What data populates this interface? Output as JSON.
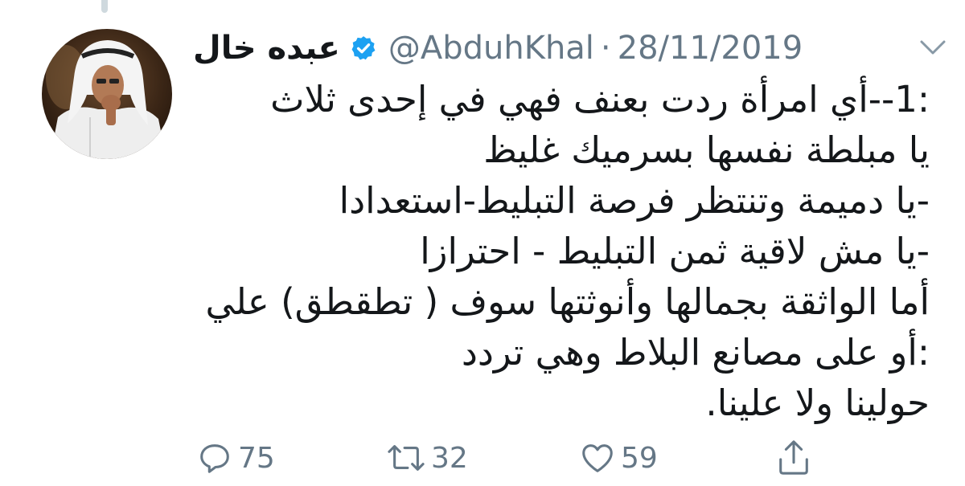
{
  "tweet": {
    "author": {
      "display_name": "عبده خال",
      "handle": "@AbduhKhal",
      "verified": true,
      "avatar_icon": "profile-photo"
    },
    "separator": "·",
    "date": "28/11/2019",
    "menu_icon": "chevron-down-icon",
    "text_lines": [
      ":1--أي امرأة ردت بعنف فهي في إحدى ثلاث",
      "يا مبلطة نفسها بسرميك غليظ",
      "-يا دميمة وتنتظر فرصة التبليط-استعدادا",
      "-يا مش لاقية ثمن التبليط - احترازا",
      "أما الواثقة بجمالها وأنوثتها سوف ( تطقطق) علي",
      ":أو على مصانع البلاط وهي تردد",
      "حولينا ولا علينا."
    ],
    "actions": {
      "reply": {
        "icon": "reply-icon",
        "count": "75"
      },
      "retweet": {
        "icon": "retweet-icon",
        "count": "32"
      },
      "like": {
        "icon": "heart-icon",
        "count": "59"
      },
      "share": {
        "icon": "share-icon"
      }
    },
    "colors": {
      "text": "#14171a",
      "secondary": "#657786",
      "verified": "#1da1f2",
      "background": "#ffffff"
    }
  }
}
